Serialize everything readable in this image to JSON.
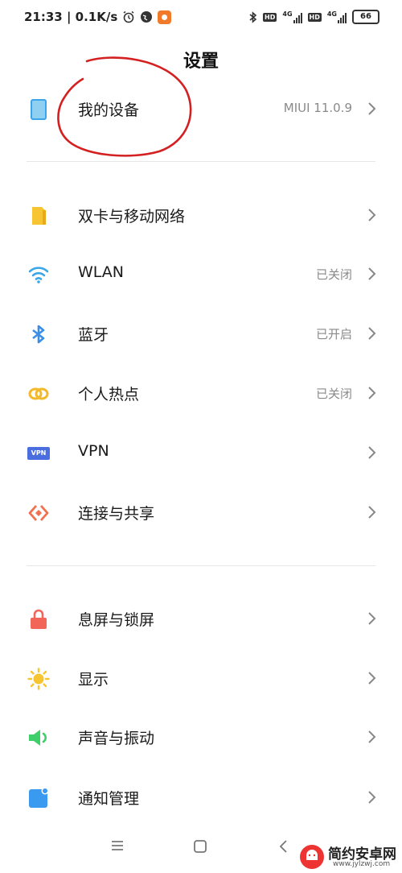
{
  "status_bar": {
    "time_speed": "21:33 | 0.1K/s",
    "hd1": "HD",
    "net1": "4G",
    "hd2": "HD",
    "net2": "4G",
    "battery": "66"
  },
  "header": {
    "title": "设置"
  },
  "my_device": {
    "label": "我的设备",
    "value": "MIUI 11.0.9"
  },
  "network_section": [
    {
      "label": "双卡与移动网络",
      "value": ""
    },
    {
      "label": "WLAN",
      "value": "已关闭"
    },
    {
      "label": "蓝牙",
      "value": "已开启"
    },
    {
      "label": "个人热点",
      "value": "已关闭"
    },
    {
      "label": "VPN",
      "value": ""
    },
    {
      "label": "连接与共享",
      "value": ""
    }
  ],
  "device_section": [
    {
      "label": "息屏与锁屏",
      "value": ""
    },
    {
      "label": "显示",
      "value": ""
    },
    {
      "label": "声音与振动",
      "value": ""
    },
    {
      "label": "通知管理",
      "value": ""
    }
  ],
  "icons": {
    "vpn_text": "VPN"
  },
  "watermark": {
    "name": "简约安卓网",
    "url": "www.jylzwj.com"
  },
  "colors": {
    "sim": "#f7c531",
    "wlan": "#3aa5e8",
    "bluetooth": "#3a8ee8",
    "hotspot": "#f2b92b",
    "vpn": "#4a6ee0",
    "share": "#f07050",
    "lock": "#f2665a",
    "display": "#f7c531",
    "sound": "#3ecf6a",
    "notify": "#3a9af0",
    "annotation": "#d42020"
  }
}
